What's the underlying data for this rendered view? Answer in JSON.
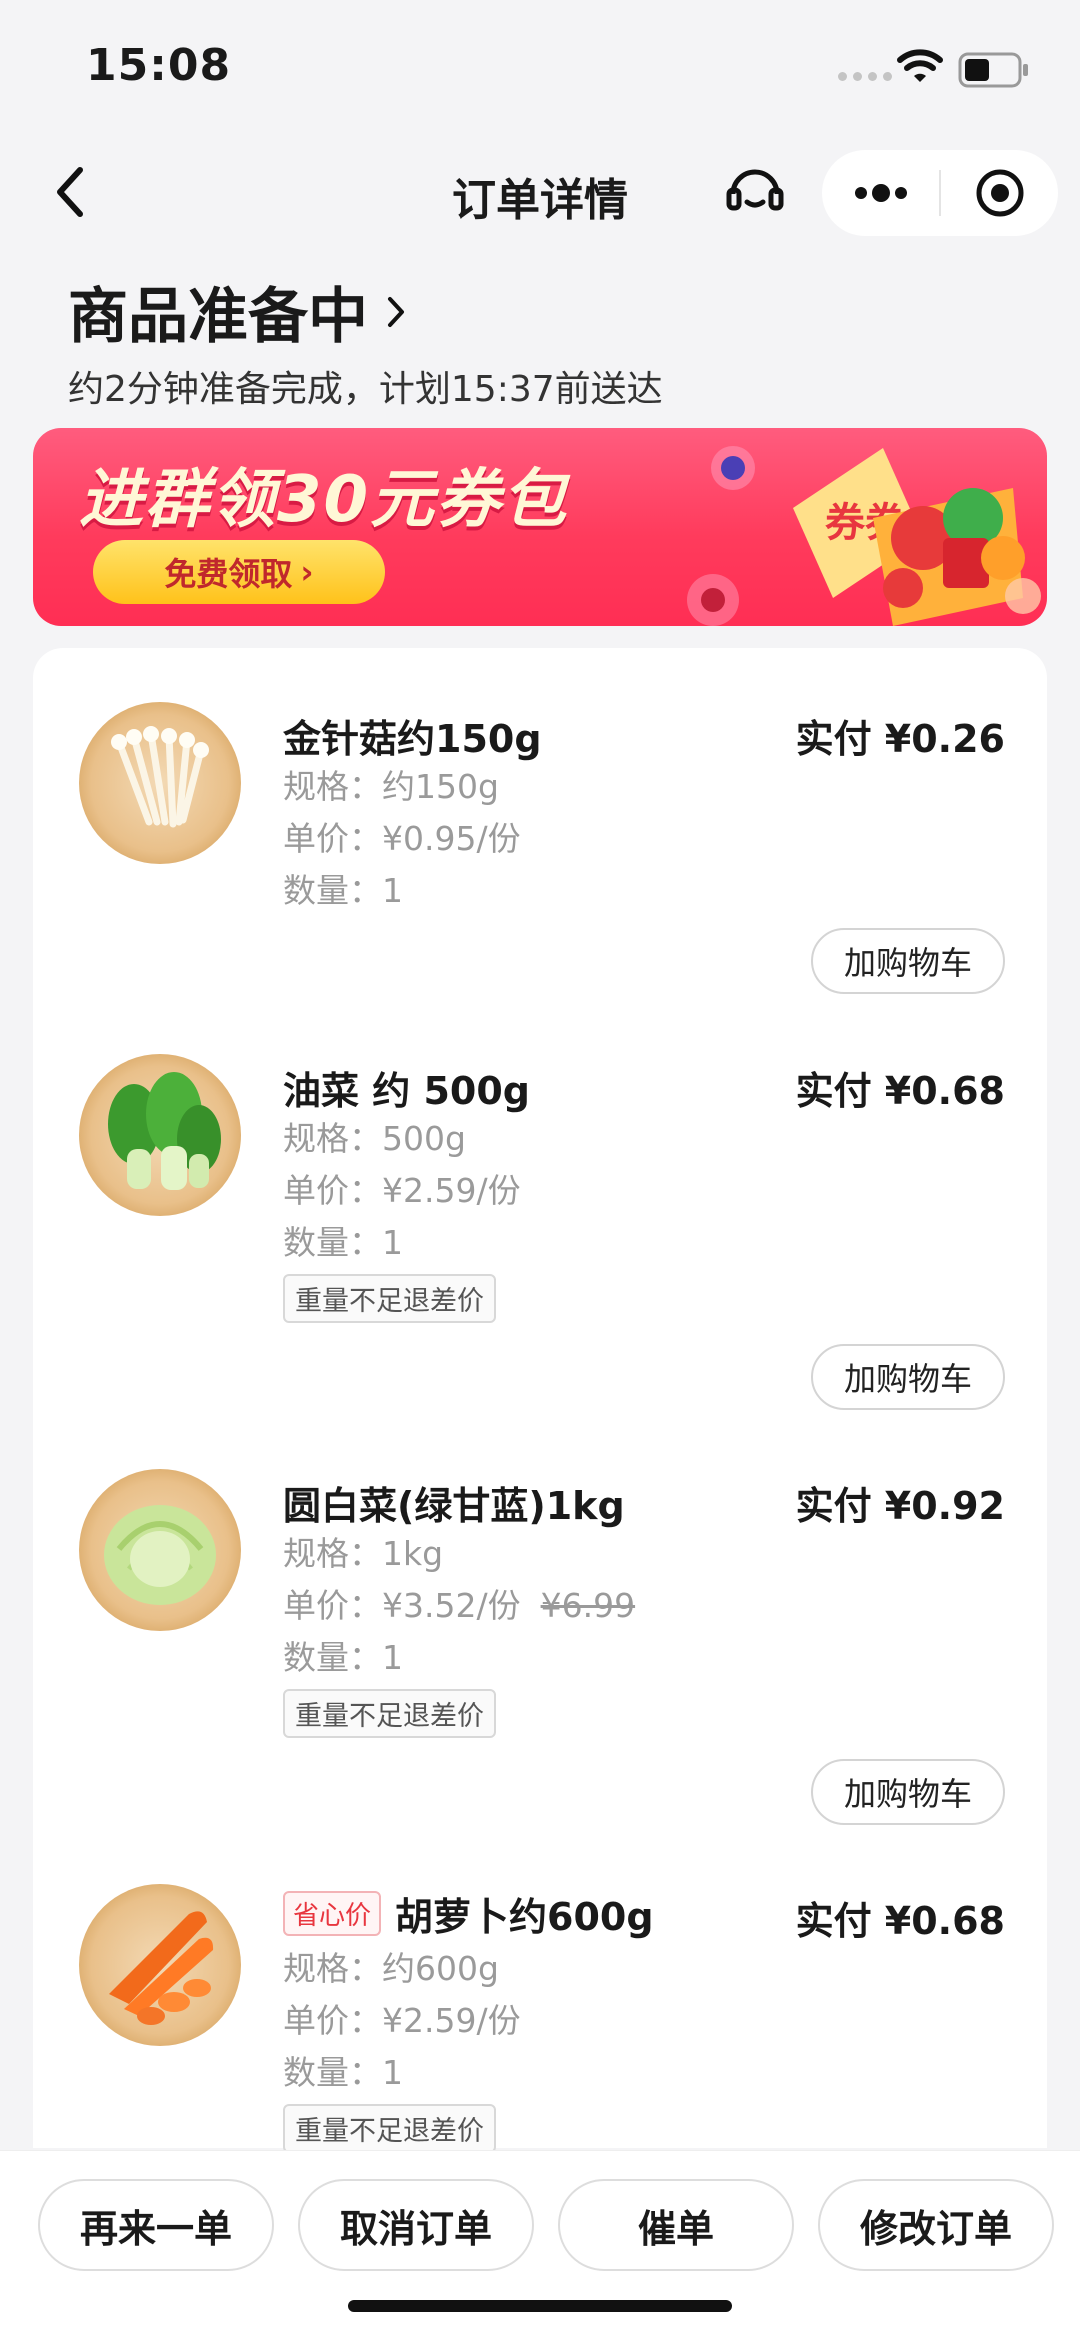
{
  "status_bar": {
    "time": "15:08"
  },
  "nav": {
    "title": "订单详情"
  },
  "order_status": {
    "title": "商品准备中",
    "subtitle": "约2分钟准备完成，计划15:37前送达"
  },
  "banner": {
    "title": "进群领30元券包",
    "button_label": "免费领取",
    "art_text": "券券"
  },
  "items": [
    {
      "name": "金针菇约150g",
      "price": "实付 ¥0.26",
      "spec": "规格：约150g",
      "unit_price": "单价：¥0.95/份",
      "qty": "数量：1",
      "tag": "",
      "cart_label": "加购物车",
      "icon": "enoki-mushroom-icon"
    },
    {
      "name": "油菜 约 500g",
      "price": "实付 ¥0.68",
      "spec": "规格：500g",
      "unit_price": "单价：¥2.59/份",
      "qty": "数量：1",
      "tag": "重量不足退差价",
      "cart_label": "加购物车",
      "icon": "bok-choy-icon"
    },
    {
      "name": "圆白菜(绿甘蓝)1kg",
      "price": "实付 ¥0.92",
      "spec": "规格：1kg",
      "unit_price": "单价：¥3.52/份",
      "original_price": "¥6.99",
      "qty": "数量：1",
      "tag": "重量不足退差价",
      "cart_label": "加购物车",
      "icon": "cabbage-icon"
    },
    {
      "name": "胡萝卜约600g",
      "promo": "省心价",
      "price": "实付 ¥0.68",
      "spec": "规格：约600g",
      "unit_price": "单价：¥2.59/份",
      "qty": "数量：1",
      "tag": "重量不足退差价",
      "icon": "carrot-icon"
    }
  ],
  "actions": [
    "再来一单",
    "取消订单",
    "催单",
    "修改订单"
  ],
  "colors": {
    "banner": "#ff3b5c",
    "banner_button": "#ffc21a",
    "promo": "#e8363f"
  }
}
